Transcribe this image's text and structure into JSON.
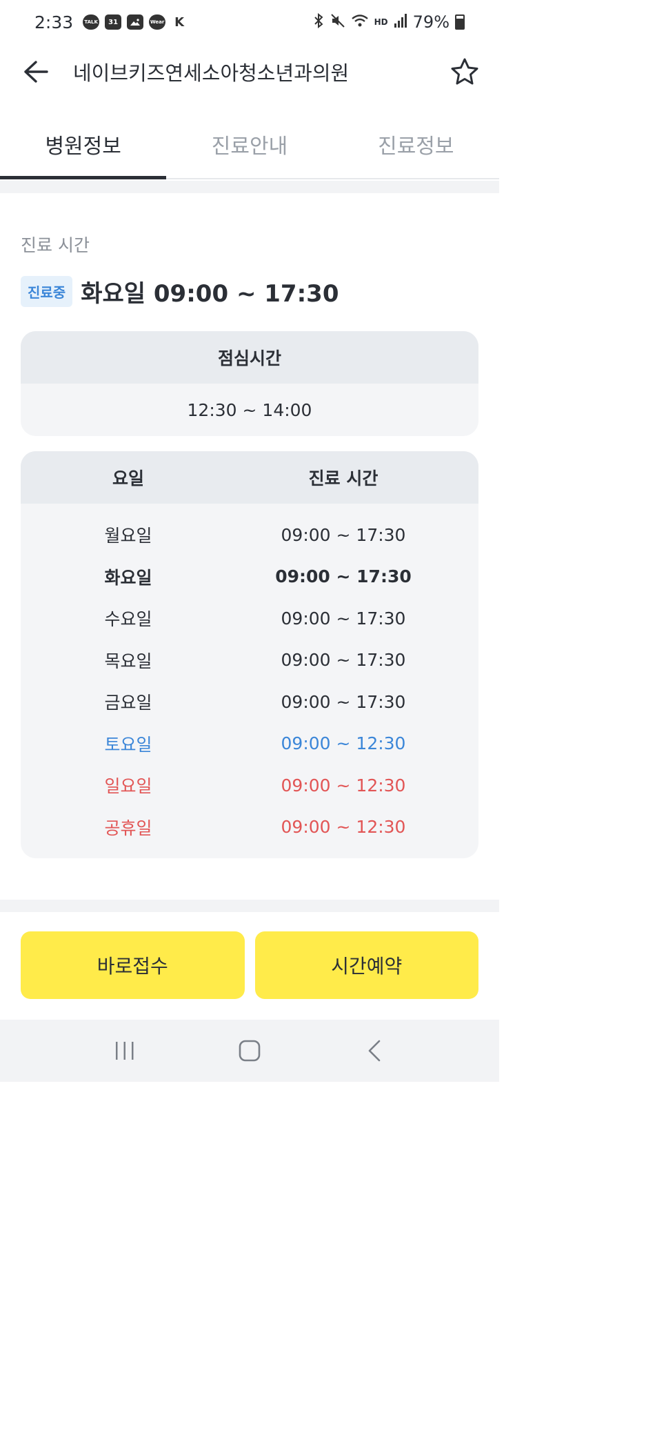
{
  "status_bar": {
    "time": "2:33",
    "notification_icons": [
      "TALK",
      "31",
      "IMG",
      "Wear",
      "K"
    ],
    "battery_text": "79%",
    "battery_level": 0.79,
    "hd_label": "HD"
  },
  "header": {
    "title": "네이브키즈연세소아청소년과의원"
  },
  "tabs": [
    {
      "label": "병원정보",
      "active": true
    },
    {
      "label": "진료안내",
      "active": false
    },
    {
      "label": "진료정보",
      "active": false
    }
  ],
  "hours": {
    "section_label": "진료 시간",
    "badge": "진료중",
    "today": "화요일 09:00 ~ 17:30",
    "lunch": {
      "title": "점심시간",
      "time": "12:30 ~ 14:00"
    },
    "table": {
      "headers": [
        "요일",
        "진료 시간"
      ],
      "rows": [
        {
          "day": "월요일",
          "time": "09:00 ~ 17:30"
        },
        {
          "day": "화요일",
          "time": "09:00 ~ 17:30"
        },
        {
          "day": "수요일",
          "time": "09:00 ~ 17:30"
        },
        {
          "day": "목요일",
          "time": "09:00 ~ 17:30"
        },
        {
          "day": "금요일",
          "time": "09:00 ~ 17:30"
        },
        {
          "day": "토요일",
          "time": "09:00 ~ 12:30"
        },
        {
          "day": "일요일",
          "time": "09:00 ~ 12:30"
        },
        {
          "day": "공휴일",
          "time": "09:00 ~ 12:30"
        }
      ]
    }
  },
  "buttons": {
    "walk_in": "바로접수",
    "reservation": "시간예약"
  },
  "colors": {
    "accent_yellow": "#ffeb4a",
    "saturday_blue": "#3b86d8",
    "sunday_red": "#e25555",
    "badge_bg": "#e6f1fb"
  },
  "nav_icons": [
    "recent-apps-icon",
    "home-icon",
    "back-icon"
  ]
}
